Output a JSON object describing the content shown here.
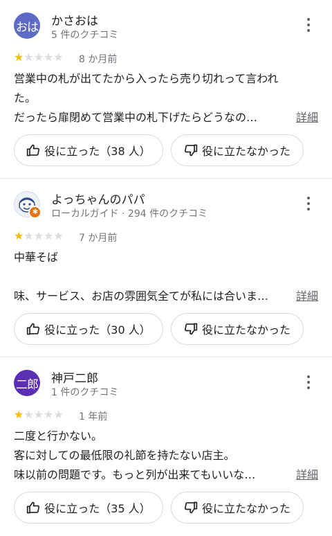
{
  "colors": {
    "star_on": "#fbbc04",
    "star_off": "#dadce0",
    "divider": "#e8eaed"
  },
  "reviews": [
    {
      "avatar_text": "おは",
      "avatar_color": "#5e6bc6",
      "avatar_icon": "profile-photo-icon",
      "name": "かさおは",
      "meta": "5 件のクチコミ",
      "rating": 1,
      "rating_max": 5,
      "date": "8 か月前",
      "lines": [
        "営業中の札が出てたから入ったら売り切れって言われ",
        "た。",
        "だったら扉閉めて営業中の札下げたらどうなの…"
      ],
      "more": "詳細",
      "helpful": "役に立った（38 人）",
      "not_helpful": "役に立たなかった"
    },
    {
      "avatar_text": "",
      "avatar_color": "#eef1f7",
      "avatar_icon": "profile-photo-icon",
      "name": "よっちゃんのパパ",
      "meta": "ローカルガイド · 294 件のクチコミ",
      "rating": 1,
      "rating_max": 5,
      "date": "7 か月前",
      "lines": [
        "中華そば",
        "",
        "味、サービス、お店の雰囲気全てが私には合いま…"
      ],
      "more": "詳細",
      "helpful": "役に立った（30 人）",
      "not_helpful": "役に立たなかった"
    },
    {
      "avatar_text": "二郎",
      "avatar_color": "#5b2fb4",
      "avatar_icon": "profile-photo-icon",
      "name": "神戸二郎",
      "meta": "1 件のクチコミ",
      "rating": 1,
      "rating_max": 5,
      "date": "1 年前",
      "lines": [
        "二度と行かない。",
        "客に対しての最低限の礼節を持たない店主。",
        "味以前の問題です。もっと列が出来てもいいな…"
      ],
      "more": "詳細",
      "helpful": "役に立った（35 人）",
      "not_helpful": "役に立たなかった"
    }
  ]
}
